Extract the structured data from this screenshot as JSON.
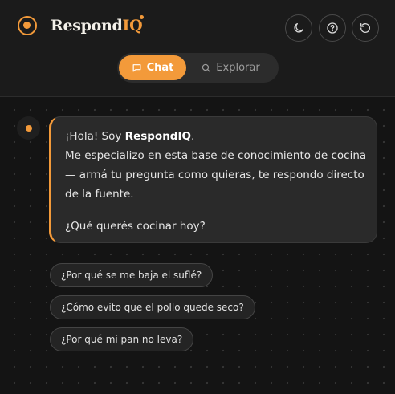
{
  "header": {
    "brand_main": "Respond",
    "brand_accent": "IQ",
    "icons": [
      "logo-icon",
      "moon-icon",
      "help-icon",
      "reset-icon"
    ]
  },
  "tabs": [
    {
      "label": "Chat",
      "icon": "chat-bubble-icon",
      "active": true
    },
    {
      "label": "Explorar",
      "icon": "search-icon",
      "active": false
    }
  ],
  "chat": {
    "greeting_prefix": "¡Hola! Soy ",
    "greeting_name": "RespondIQ",
    "greeting_suffix": ".",
    "intro_line1": "Me especializo en esta base de conocimiento de cocina",
    "intro_line2": "— armá tu pregunta como quieras, te respondo directo",
    "intro_line3": "de la fuente.",
    "question": "¿Qué querés cocinar hoy?"
  },
  "suggestions": [
    "¿Por qué se me baja el suflé?",
    "¿Cómo evito que el pollo quede seco?",
    "¿Por qué mi pan no leva?"
  ],
  "colors": {
    "accent": "#f39a3a",
    "background": "#141414",
    "bubble": "#2a2a2a"
  }
}
